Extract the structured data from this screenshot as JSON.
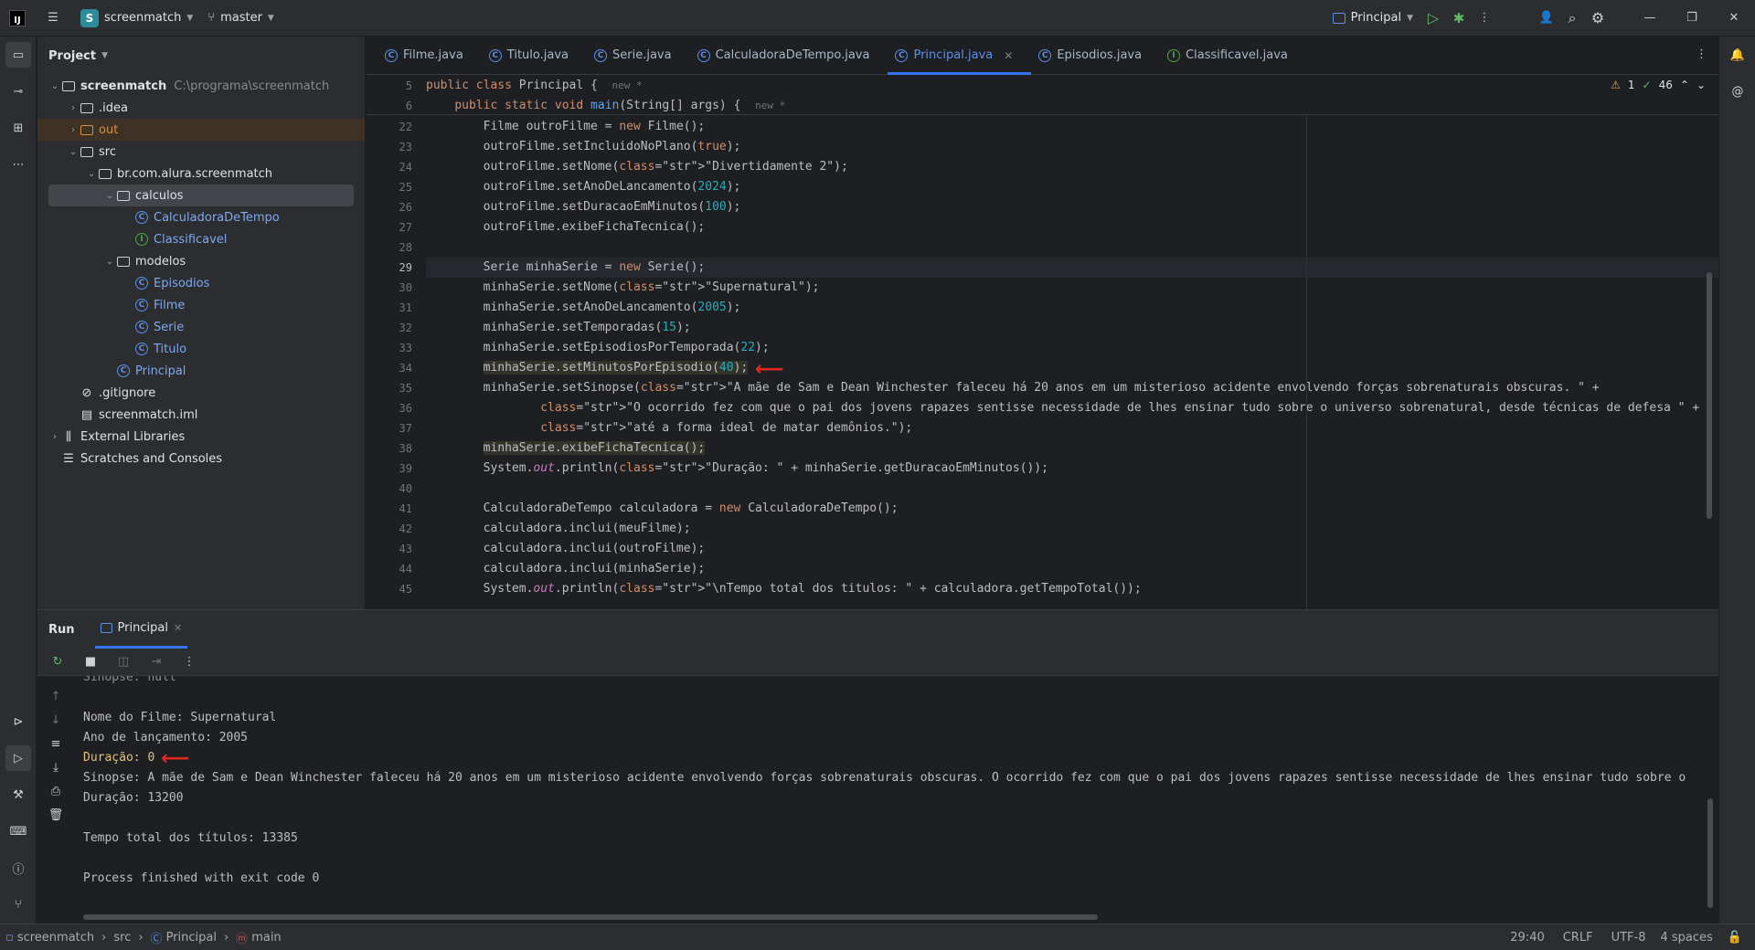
{
  "topbar": {
    "project_badge": "S",
    "project_name": "screenmatch",
    "branch": "master",
    "run_config": "Principal"
  },
  "project_panel": {
    "title": "Project",
    "tree": [
      {
        "label": "screenmatch",
        "path": "C:\\programa\\screenmatch",
        "kind": "module",
        "depth": 0,
        "expanded": true
      },
      {
        "label": ".idea",
        "kind": "folder",
        "depth": 1,
        "expanded": false
      },
      {
        "label": "out",
        "kind": "folder-orange",
        "depth": 1,
        "expanded": false
      },
      {
        "label": "src",
        "kind": "folder",
        "depth": 1,
        "expanded": true
      },
      {
        "label": "br.com.alura.screenmatch",
        "kind": "package",
        "depth": 2,
        "expanded": true
      },
      {
        "label": "calculos",
        "kind": "package",
        "depth": 3,
        "expanded": true,
        "selected": true
      },
      {
        "label": "CalculadoraDeTempo",
        "kind": "class",
        "depth": 4
      },
      {
        "label": "Classificavel",
        "kind": "interface",
        "depth": 4
      },
      {
        "label": "modelos",
        "kind": "package",
        "depth": 3,
        "expanded": true
      },
      {
        "label": "Episodios",
        "kind": "class",
        "depth": 4
      },
      {
        "label": "Filme",
        "kind": "class",
        "depth": 4
      },
      {
        "label": "Serie",
        "kind": "class",
        "depth": 4
      },
      {
        "label": "Titulo",
        "kind": "class",
        "depth": 4
      },
      {
        "label": "Principal",
        "kind": "class",
        "depth": 3
      },
      {
        "label": ".gitignore",
        "kind": "ignore",
        "depth": 1
      },
      {
        "label": "screenmatch.iml",
        "kind": "file",
        "depth": 1
      },
      {
        "label": "External Libraries",
        "kind": "lib",
        "depth": 0,
        "expanded": false
      },
      {
        "label": "Scratches and Consoles",
        "kind": "scratch",
        "depth": 0
      }
    ]
  },
  "tabs": [
    {
      "label": "Filme.java",
      "kind": "class"
    },
    {
      "label": "Titulo.java",
      "kind": "class"
    },
    {
      "label": "Serie.java",
      "kind": "class"
    },
    {
      "label": "CalculadoraDeTempo.java",
      "kind": "class"
    },
    {
      "label": "Principal.java",
      "kind": "class",
      "active": true
    },
    {
      "label": "Episodios.java",
      "kind": "class"
    },
    {
      "label": "Classificavel.java",
      "kind": "interface"
    }
  ],
  "inspections": {
    "warnings": "1",
    "ok": "46"
  },
  "sticky": [
    {
      "num": "5",
      "text": "public class Principal {",
      "hint": "new *"
    },
    {
      "num": "6",
      "text": "    public static void main(String[] args) {",
      "hint": "new *"
    }
  ],
  "code": [
    {
      "num": "22",
      "text": "        Filme outroFilme = new Filme();"
    },
    {
      "num": "23",
      "text": "        outroFilme.setIncluidoNoPlano(true);"
    },
    {
      "num": "24",
      "text": "        outroFilme.setNome(\"Divertidamente 2\");"
    },
    {
      "num": "25",
      "text": "        outroFilme.setAnoDeLancamento(2024);"
    },
    {
      "num": "26",
      "text": "        outroFilme.setDuracaoEmMinutos(100);"
    },
    {
      "num": "27",
      "text": "        outroFilme.exibeFichaTecnica();"
    },
    {
      "num": "28",
      "text": ""
    },
    {
      "num": "29",
      "text": "        Serie minhaSerie = new Serie();",
      "current": true
    },
    {
      "num": "30",
      "text": "        minhaSerie.setNome(\"Supernatural\");"
    },
    {
      "num": "31",
      "text": "        minhaSerie.setAnoDeLancamento(2005);"
    },
    {
      "num": "32",
      "text": "        minhaSerie.setTemporadas(15);"
    },
    {
      "num": "33",
      "text": "        minhaSerie.setEpisodiosPorTemporada(22);"
    },
    {
      "num": "34",
      "text": "        minhaSerie.setMinutosPorEpisodio(40);",
      "highlight": true
    },
    {
      "num": "35",
      "text": "        minhaSerie.setSinopse(\"A mãe de Sam e Dean Winchester faleceu há 20 anos em um misterioso acidente envolvendo forças sobrenaturais obscuras. \" +"
    },
    {
      "num": "36",
      "text": "                \"O ocorrido fez com que o pai dos jovens rapazes sentisse necessidade de lhes ensinar tudo sobre o universo sobrenatural, desde técnicas de defesa \" +"
    },
    {
      "num": "37",
      "text": "                \"até a forma ideal de matar demônios.\");"
    },
    {
      "num": "38",
      "text": "        minhaSerie.exibeFichaTecnica();",
      "highlight": true
    },
    {
      "num": "39",
      "text": "        System.out.println(\"Duração: \" + minhaSerie.getDuracaoEmMinutos());"
    },
    {
      "num": "40",
      "text": ""
    },
    {
      "num": "41",
      "text": "        CalculadoraDeTempo calculadora = new CalculadoraDeTempo();"
    },
    {
      "num": "42",
      "text": "        calculadora.inclui(meuFilme);"
    },
    {
      "num": "43",
      "text": "        calculadora.inclui(outroFilme);"
    },
    {
      "num": "44",
      "text": "        calculadora.inclui(minhaSerie);"
    },
    {
      "num": "45",
      "text": "        System.out.println(\"\\nTempo total dos titulos: \" + calculadora.getTempoTotal());"
    }
  ],
  "run": {
    "title": "Run",
    "tab": "Principal",
    "output": [
      {
        "text": "Sinopse: null",
        "partial": true
      },
      {
        "text": ""
      },
      {
        "text": "Nome do Filme: Supernatural"
      },
      {
        "text": "Ano de lançamento: 2005"
      },
      {
        "text": "Duração: 0",
        "warn": true
      },
      {
        "text": "Sinopse: A mãe de Sam e Dean Winchester faleceu há 20 anos em um misterioso acidente envolvendo forças sobrenaturais obscuras. O ocorrido fez com que o pai dos jovens rapazes sentisse necessidade de lhes ensinar tudo sobre o"
      },
      {
        "text": "Duração: 13200"
      },
      {
        "text": ""
      },
      {
        "text": "Tempo total dos títulos: 13385"
      },
      {
        "text": ""
      },
      {
        "text": "Process finished with exit code 0"
      }
    ]
  },
  "status": {
    "breadcrumbs": [
      "screenmatch",
      "src",
      "Principal",
      "main"
    ],
    "position": "29:40",
    "line_sep": "CRLF",
    "encoding": "UTF-8",
    "indent": "4 spaces"
  },
  "colors": {
    "accent": "#3574f0",
    "annotation": "#e0271f"
  }
}
